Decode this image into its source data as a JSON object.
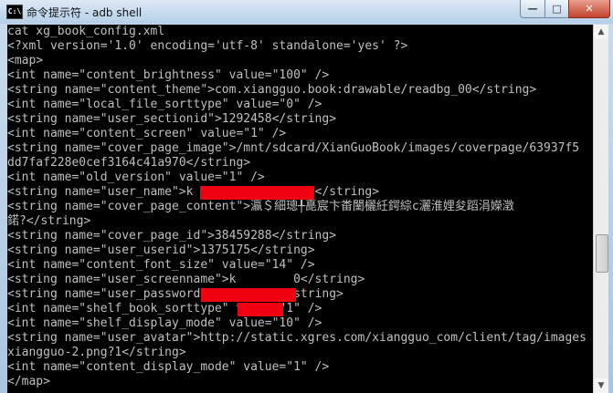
{
  "window": {
    "title": "命令提示符 - adb  shell",
    "icon_label": "C:\\",
    "buttons": {
      "minimize": "—",
      "maximize": "□",
      "close": "✕"
    },
    "colors": {
      "console_bg": "#000000",
      "console_text": "#c0c0c0",
      "redaction": "#f00010",
      "close_button": "#c4432b"
    }
  },
  "console": {
    "lines": [
      "cat xg_book_config.xml",
      "<?xml version='1.0' encoding='utf-8' standalone='yes' ?>",
      "<map>",
      "<int name=\"content_brightness\" value=\"100\" />",
      "<string name=\"content_theme\">com.xiangguo.book:drawable/readbg_00</string>",
      "<int name=\"local_file_sorttype\" value=\"0\" />",
      "<string name=\"user_sectionid\">1292458</string>",
      "<int name=\"content_screen\" value=\"1\" />",
      "<string name=\"cover_page_image\">/mnt/sdcard/XianGuoBook/images/coverpage/63937f5",
      "dd7faf228e0cef3164c41a970</string>",
      "<int name=\"old_version\" value=\"1\" />",
      "<string name=\"user_name\">k             .com</string>",
      "<string name=\"cover_page_content\">瀛＄細璁╀嗭宸卞畨闉欐紝鍔綜c灑淮娌夋蹈涓嬫澂",
      "鍩?</string>",
      "<string name=\"cover_page_id\">38459288</string>",
      "<string name=\"user_userid\">1375175</string>",
      "<int name=\"content_font_size\" value=\"14\" />",
      "<string name=\"user_screenname\">k        0</string>",
      "<string name=\"user_password\">t1       </string>",
      "<int name=\"shelf_book_sorttype\" value=\"1\" />",
      "<int name=\"shelf_display_mode\" value=\"10\" />",
      "<string name=\"user_avatar\">http://static.xgres.com/xiangguo_com/client/tag/images",
      "xiangguo-2.png?1</string>",
      "<int name=\"content_display_mode\" value=\"1\" />",
      "</map>"
    ]
  },
  "scrollbar": {
    "up_arrow": "▲",
    "down_arrow": "▼"
  }
}
